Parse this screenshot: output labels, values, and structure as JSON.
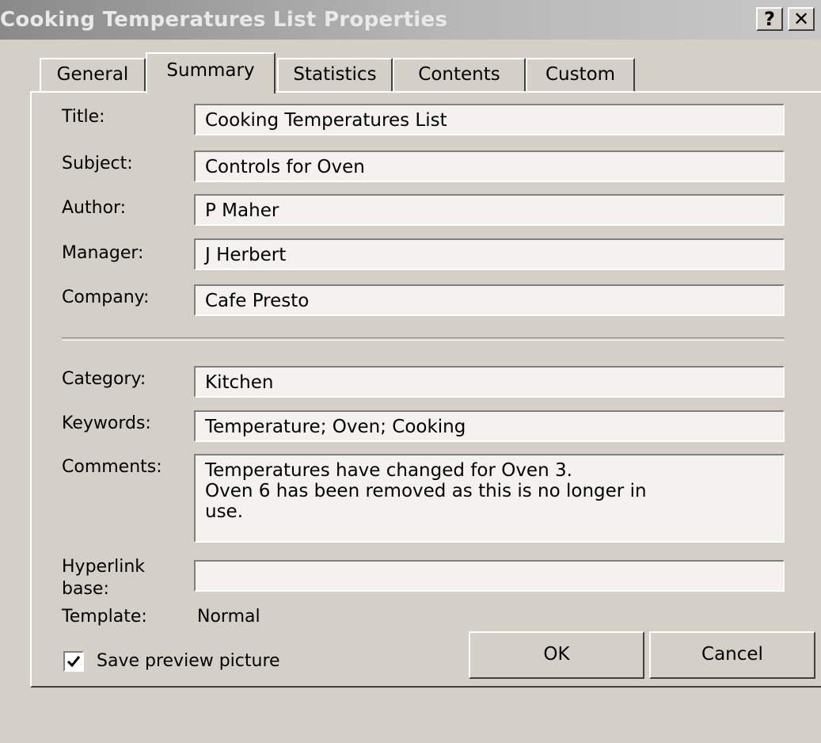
{
  "dialog": {
    "title": "Cooking Temperatures List Properties",
    "help_label": "?",
    "close_label": "✕"
  },
  "tabs": [
    {
      "label": "General"
    },
    {
      "label": "Summary",
      "active": true
    },
    {
      "label": "Statistics"
    },
    {
      "label": "Contents"
    },
    {
      "label": "Custom"
    }
  ],
  "fields": {
    "title": {
      "label": "Title:",
      "value": "Cooking Temperatures List"
    },
    "subject": {
      "label": "Subject:",
      "value": "Controls for Oven"
    },
    "author": {
      "label": "Author:",
      "value": "P Maher"
    },
    "manager": {
      "label": "Manager:",
      "value": "J Herbert"
    },
    "company": {
      "label": "Company:",
      "value": "Cafe Presto"
    },
    "category": {
      "label": "Category:",
      "value": "Kitchen"
    },
    "keywords": {
      "label": "Keywords:",
      "value": "Temperature; Oven; Cooking"
    },
    "comments": {
      "label": "Comments:",
      "value": "Temperatures have changed for Oven 3.\nOven 6 has been removed as this is no longer in\nuse."
    },
    "hyperlink_base": {
      "label_line1": "Hyperlink",
      "label_line2": "base:",
      "value": ""
    },
    "template": {
      "label": "Template:",
      "value": "Normal"
    }
  },
  "save_preview": {
    "label": "Save preview picture",
    "checked": true
  },
  "buttons": {
    "ok": "OK",
    "cancel": "Cancel"
  }
}
